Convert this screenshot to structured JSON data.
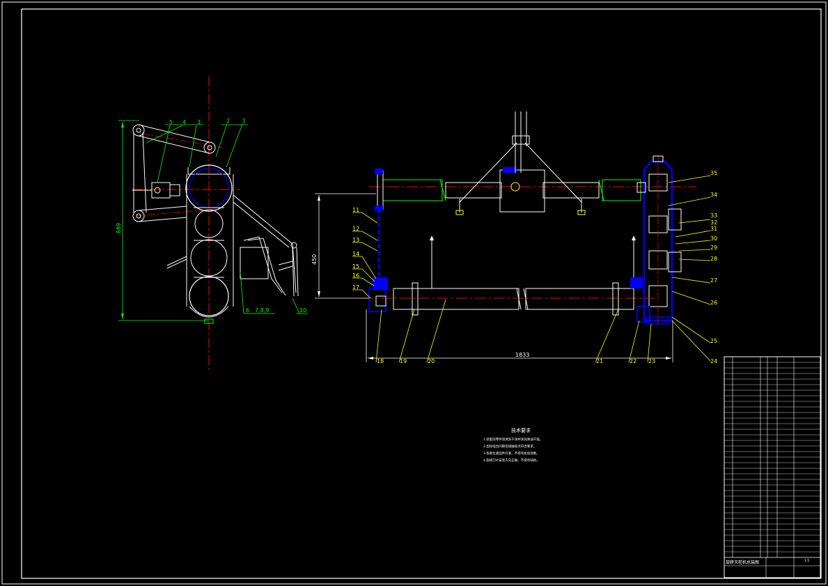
{
  "drawing": {
    "colors": {
      "background": "#000000",
      "outline": "#ffffff",
      "centerline": "#ff0000",
      "section": "#0000ff",
      "shaft": "#00ff00",
      "leader_side": "#00ff00",
      "leader_front": "#ffff00"
    },
    "side_view": {
      "labels": [
        "1",
        "2",
        "3",
        "4",
        "5",
        "6",
        "7,8,9",
        "10"
      ],
      "dimension": "889"
    },
    "front_view": {
      "labels": [
        "11",
        "12",
        "13",
        "14",
        "15",
        "16",
        "17",
        "18",
        "19",
        "20",
        "21",
        "22",
        "23",
        "24",
        "25",
        "26",
        "27",
        "28",
        "29",
        "30",
        "31",
        "32",
        "33",
        "34",
        "35"
      ],
      "dim_height": "450",
      "dim_width": "1833"
    },
    "tech_requirements": {
      "title": "技术要求",
      "lines": [
        "1.装配前零件须清洗干净并涂润滑油干燥。",
        "2.齿轮啮合间隙及接触斑点符合要求。",
        "3.各部位紧固件拧紧，不得有松动现象。",
        "4.旋耕刀片安装方向正确，不得有缺损。"
      ]
    },
    "title_block": {
      "name": "旋耕灭茬机总装图",
      "scale": "1:5"
    }
  }
}
